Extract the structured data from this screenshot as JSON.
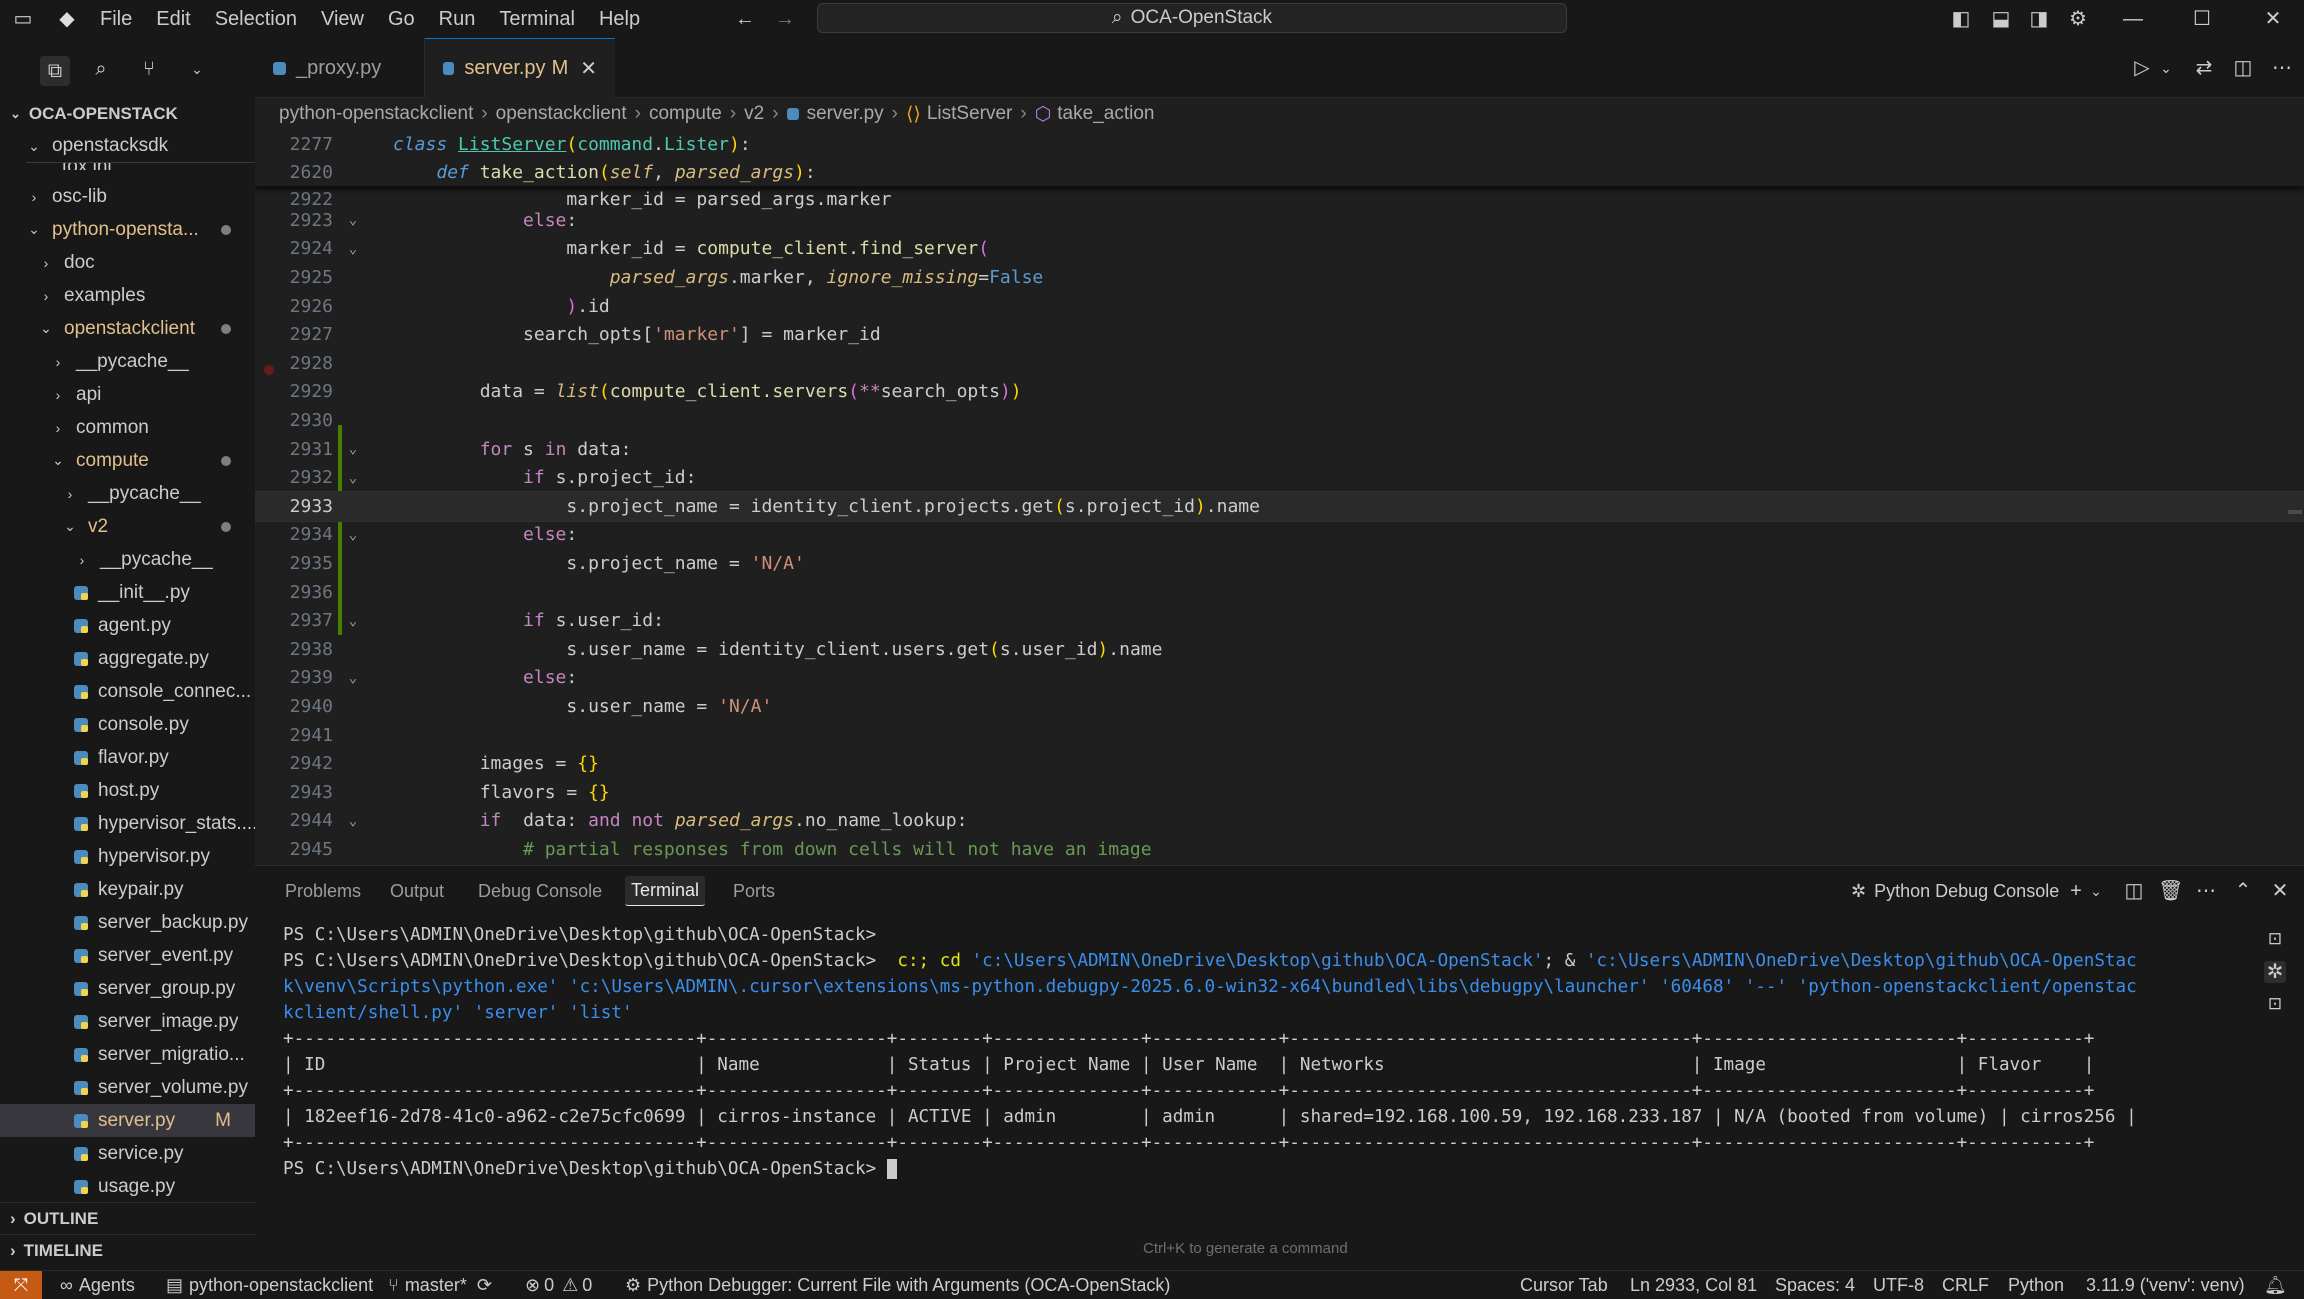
{
  "menu": [
    "File",
    "Edit",
    "Selection",
    "View",
    "Go",
    "Run",
    "Terminal",
    "Help"
  ],
  "search": {
    "text": "OCA-OpenStack"
  },
  "explorer": {
    "title": "OCA-OPENSTACK",
    "items": [
      {
        "label": "openstacksdk",
        "kind": "folder",
        "open": true
      },
      {
        "label": "tox.ini",
        "kind": "file"
      },
      {
        "label": "osc-lib",
        "kind": "folder",
        "open": false
      },
      {
        "label": "python-opensta...",
        "kind": "folder",
        "open": true
      },
      {
        "label": "doc",
        "kind": "folder",
        "open": false
      },
      {
        "label": "examples",
        "kind": "folder",
        "open": false
      },
      {
        "label": "openstackclient",
        "kind": "folder",
        "open": true
      },
      {
        "label": "__pycache__",
        "kind": "folder",
        "open": false
      },
      {
        "label": "api",
        "kind": "folder",
        "open": false
      },
      {
        "label": "common",
        "kind": "folder",
        "open": false
      },
      {
        "label": "compute",
        "kind": "folder",
        "open": true
      },
      {
        "label": "__pycache__",
        "kind": "folder",
        "open": false
      },
      {
        "label": "v2",
        "kind": "folder",
        "open": true
      },
      {
        "label": "__pycache__",
        "kind": "folder",
        "open": false
      },
      {
        "label": "__init__.py",
        "kind": "py"
      },
      {
        "label": "agent.py",
        "kind": "py"
      },
      {
        "label": "aggregate.py",
        "kind": "py"
      },
      {
        "label": "console_connec...",
        "kind": "py"
      },
      {
        "label": "console.py",
        "kind": "py"
      },
      {
        "label": "flavor.py",
        "kind": "py"
      },
      {
        "label": "host.py",
        "kind": "py"
      },
      {
        "label": "hypervisor_stats....",
        "kind": "py"
      },
      {
        "label": "hypervisor.py",
        "kind": "py"
      },
      {
        "label": "keypair.py",
        "kind": "py"
      },
      {
        "label": "server_backup.py",
        "kind": "py"
      },
      {
        "label": "server_event.py",
        "kind": "py"
      },
      {
        "label": "server_group.py",
        "kind": "py"
      },
      {
        "label": "server_image.py",
        "kind": "py"
      },
      {
        "label": "server_migratio...",
        "kind": "py"
      },
      {
        "label": "server_volume.py",
        "kind": "py"
      },
      {
        "label": "server.py",
        "kind": "py",
        "badge": "M"
      },
      {
        "label": "service.py",
        "kind": "py"
      },
      {
        "label": "usage.py",
        "kind": "py"
      }
    ],
    "outline": "OUTLINE",
    "timeline": "TIMELINE"
  },
  "tabs": [
    {
      "label": "_proxy.py"
    },
    {
      "label": "server.py",
      "badge": "M"
    }
  ],
  "breadcrumb": [
    "python-openstackclient",
    "openstackclient",
    "compute",
    "v2",
    "server.py",
    "ListServer",
    "take_action"
  ],
  "editor": {
    "sticky_lines": [
      "2277",
      "2620"
    ],
    "line_numbers": [
      "2922",
      "2923",
      "2924",
      "2925",
      "2926",
      "2927",
      "2928",
      "2929",
      "2930",
      "2931",
      "2932",
      "2933",
      "2934",
      "2935",
      "2936",
      "2937",
      "2938",
      "2939",
      "2940",
      "2941",
      "2942",
      "2943",
      "2944",
      "2945"
    ],
    "code": {
      "l2922": "marker_id = parsed_args.marker",
      "class_kw": "class",
      "class_name": "ListServer",
      "class_base_a": "command",
      "class_base_b": "Lister",
      "def_kw": "def",
      "def_name": "take_action",
      "self": "self",
      "parsed_args": "parsed_args",
      "else": "else",
      "marker_id": "marker_id",
      "compute_client_find": "compute_client.find_server",
      "marker_arg": ".marker, ",
      "ignore_missing": "ignore_missing",
      "false": "False",
      "id": ".id",
      "search_opts": "search_opts[",
      "marker_str": "'marker'",
      "eq_marker": "] = marker_id",
      "data_eq": "data = ",
      "list": "list",
      "servers_call": "compute_client.servers",
      "star": "**",
      "search_opts2": "search_opts",
      "for": "for",
      "in": "in",
      "s": " s ",
      "data_colon": " data:",
      "if": "if",
      "project_id": " s.project_id:",
      "proj_name_eq": "s.project_name = identity_client.projects.get",
      "s_project_id": "s.project_id",
      "name": ".name",
      "proj_name_na": "s.project_name = ",
      "na": "'N/A'",
      "user_id": " s.user_id:",
      "user_name_eq": "s.user_name = identity_client.users.get",
      "s_user_id": "s.user_id",
      "user_name_na": "s.user_name = ",
      "images": "images = ",
      "flavors": "flavors = ",
      "braces": "{}",
      "and": "and",
      "not": "not",
      "no_name_lookup": ".no_name_lookup:",
      "comment": "# partial responses from down cells will not have an image"
    }
  },
  "panel": {
    "tabs": [
      "Problems",
      "Output",
      "Debug Console",
      "Terminal",
      "Ports"
    ],
    "active_tab": "Terminal",
    "session": "Python Debug Console",
    "prompt1": "PS C:\\Users\\ADMIN\\OneDrive\\Desktop\\github\\OCA-OpenStack>",
    "cmd_c": "c:; ",
    "cmd_cd": "cd ",
    "cmd_path": "'c:\\Users\\ADMIN\\OneDrive\\Desktop\\github\\OCA-OpenStack'",
    "cmd_amp": "; & ",
    "cmd_rest1": "'c:\\Users\\ADMIN\\OneDrive\\Desktop\\github\\OCA-OpenStac",
    "cmd_rest2": "k\\venv\\Scripts\\python.exe' 'c:\\Users\\ADMIN\\.cursor\\extensions\\ms-python.debugpy-2025.6.0-win32-x64\\bundled\\libs\\debugpy\\launcher' '60468' '--' 'python-openstackclient/openstac",
    "cmd_rest3": "kclient/shell.py' 'server' 'list'",
    "table_border": "+--------------------------------------+-----------------+--------+--------------+------------+--------------------------------------+------------------------+-----------+",
    "table_header": "| ID                                   | Name            | Status | Project Name | User Name  | Networks                             | Image                  | Flavor    |",
    "table_row": "| 182eef16-2d78-41c0-a962-c2e75cfc0699 | cirros-instance | ACTIVE | admin        | admin      | shared=192.168.100.59, 192.168.233.187 | N/A (booted from volume) | cirros256 |",
    "prompt2": "PS C:\\Users\\ADMIN\\OneDrive\\Desktop\\github\\OCA-OpenStack>",
    "hint": "Ctrl+K to generate a command"
  },
  "status": {
    "agents": "Agents",
    "project": "python-openstackclient",
    "branch": "master*",
    "errors": "0",
    "warnings": "0",
    "debugger": "Python Debugger: Current File with Arguments (OCA-OpenStack)",
    "cursor_tab": "Cursor Tab",
    "position": "Ln 2933, Col 81",
    "spaces": "Spaces: 4",
    "encoding": "UTF-8",
    "eol": "CRLF",
    "language": "Python",
    "interpreter": "3.11.9 ('venv': venv)"
  }
}
